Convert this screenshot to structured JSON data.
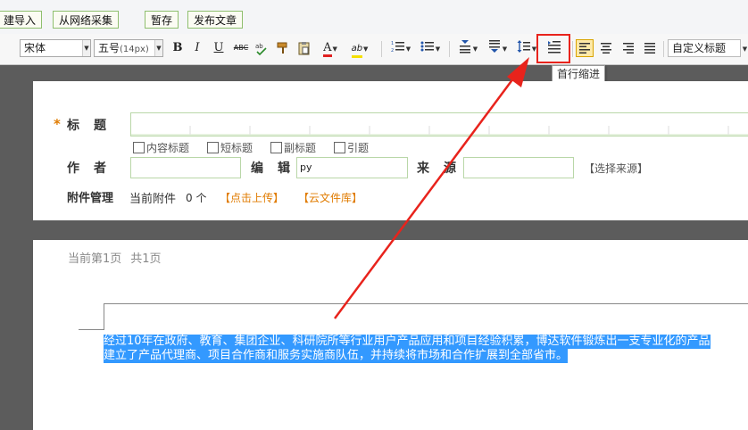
{
  "topbar": {
    "import": "建导入",
    "collect": "从网络采集",
    "draft": "暂存",
    "publish": "发布文章"
  },
  "toolbar": {
    "font_family": "宋体",
    "font_size": "五号",
    "font_size_px": "(14px)",
    "style": "自定义标题",
    "bold": "B",
    "italic": "I",
    "underline": "U",
    "strike": "ABC",
    "font_color": "A",
    "highlight": "ab"
  },
  "tooltip": "首行缩进",
  "form": {
    "title_label": "标　题",
    "checkboxes": [
      "内容标题",
      "短标题",
      "副标题",
      "引题"
    ],
    "author_label": "作　者",
    "editor_label": "编　辑",
    "editor_value": "py",
    "source_label": "来　源",
    "choose_source": "【选择来源】",
    "attach_label": "附件管理",
    "attach_current": "当前附件",
    "attach_count": "0 个",
    "upload": "【点击上传】",
    "cloud": "【云文件库】",
    "required_mark": "*"
  },
  "editor": {
    "page_info": "当前第1页",
    "page_total": "共1页",
    "lines": [
      "经过10年在政府、教育、集团企业、科研院所等行业用户产品应用和项目经验积累，博达软件锻炼出一支专业化的产品",
      "建立了产品代理商、项目合作商和服务实施商队伍，并持续将市场和合作扩展到全部省市。"
    ]
  },
  "colors": {
    "arrow": "#e8231c",
    "selection": "#3399ff",
    "accent_orange": "#e07b00"
  }
}
